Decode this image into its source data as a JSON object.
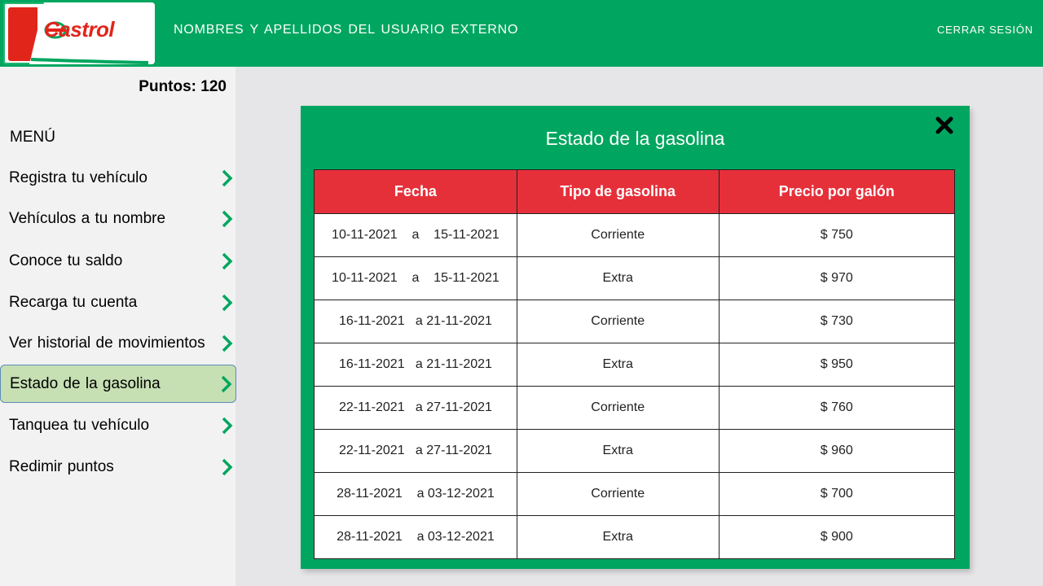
{
  "header": {
    "logo_text": "Castrol",
    "user_name": "NOMBRES  Y APELLIDOS  DEL  USUARIO  EXTERNO",
    "logout_label": "CERRAR  SESIÓN",
    "brand_color": "#00a65f",
    "logo_red": "#e1251b"
  },
  "sidebar": {
    "points_label": "Puntos: 120",
    "menu_title": "MENÚ",
    "items": [
      {
        "label": "Registra tu vehículo",
        "active": false
      },
      {
        "label": "Vehículos  a tu nombre",
        "active": false
      },
      {
        "label": "Conoce  tu saldo",
        "active": false
      },
      {
        "label": "Recarga  tu cuenta",
        "active": false
      },
      {
        "label": "Ver historial  de movimientos",
        "active": false
      },
      {
        "label": "Estado de la gasolina",
        "active": true
      },
      {
        "label": "Tanquea  tu vehículo",
        "active": false
      },
      {
        "label": "Redimir  puntos",
        "active": false
      }
    ],
    "active_color": "#c6e0b4",
    "chevron_icon": "chevron-right-icon"
  },
  "modal": {
    "title": "Estado de la gasolina",
    "close_icon": "close-icon",
    "table": {
      "headers": [
        "Fecha",
        "Tipo de gasolina",
        "Precio por galón"
      ],
      "header_color": "#e5303a",
      "rows": [
        [
          "10-11-2021    a    15-11-2021",
          "Corriente",
          "$ 750"
        ],
        [
          "10-11-2021    a    15-11-2021",
          "Extra",
          "$ 970"
        ],
        [
          "16-11-2021   a 21-11-2021",
          "Corriente",
          "$ 730"
        ],
        [
          "16-11-2021   a 21-11-2021",
          "Extra",
          "$ 950"
        ],
        [
          "22-11-2021   a 27-11-2021",
          "Corriente",
          "$ 760"
        ],
        [
          "22-11-2021   a 27-11-2021",
          "Extra",
          "$ 960"
        ],
        [
          "28-11-2021    a 03-12-2021",
          "Corriente",
          "$ 700"
        ],
        [
          "28-11-2021    a 03-12-2021",
          "Extra",
          "$ 900"
        ]
      ]
    }
  }
}
